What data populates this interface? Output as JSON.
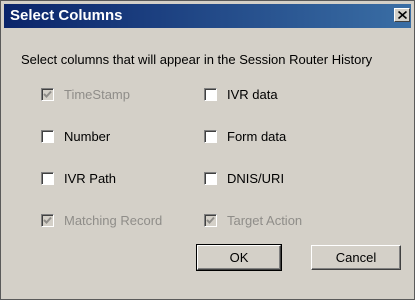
{
  "window": {
    "title": "Select Columns",
    "close_glyph": "close-icon"
  },
  "instructions": "Select columns that will appear in the Session Router History",
  "checkboxes": [
    {
      "label": "TimeStamp",
      "checked": true,
      "enabled": false
    },
    {
      "label": "IVR data",
      "checked": false,
      "enabled": true
    },
    {
      "label": "Number",
      "checked": false,
      "enabled": true
    },
    {
      "label": "Form data",
      "checked": false,
      "enabled": true
    },
    {
      "label": "IVR Path",
      "checked": false,
      "enabled": true
    },
    {
      "label": "DNIS/URI",
      "checked": false,
      "enabled": true
    },
    {
      "label": "Matching Record",
      "checked": true,
      "enabled": false
    },
    {
      "label": "Target Action",
      "checked": true,
      "enabled": false
    }
  ],
  "buttons": {
    "ok": "OK",
    "cancel": "Cancel"
  },
  "colors": {
    "title_bar": "#0a246a",
    "dialog_face": "#d4d0c8",
    "disabled_text": "#8f8d89"
  }
}
